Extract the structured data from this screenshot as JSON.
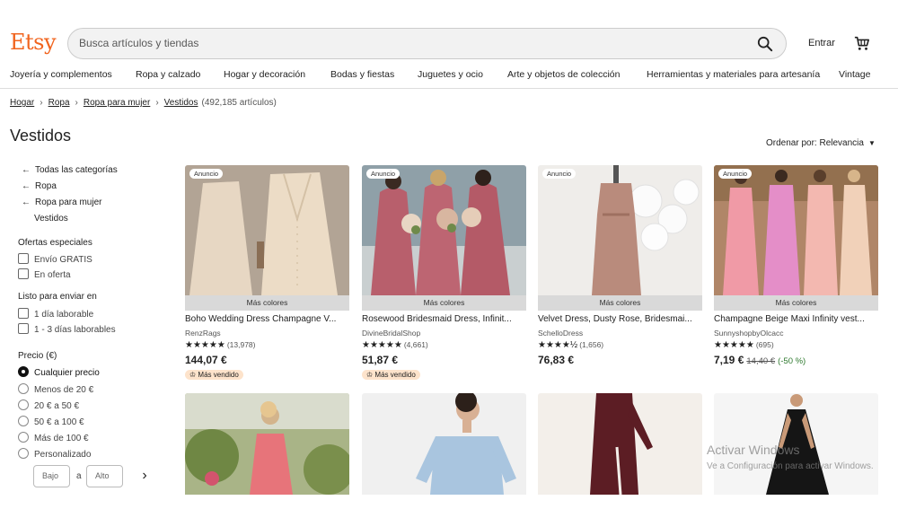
{
  "header": {
    "logo": "Etsy",
    "search_placeholder": "Busca artículos y tiendas",
    "signin": "Entrar"
  },
  "categories": [
    "Joyería y complementos",
    "Ropa y calzado",
    "Hogar y decoración",
    "Bodas y fiestas",
    "Juguetes y ocio",
    "Arte y objetos de colección",
    "Herramientas y materiales para artesanía",
    "Vintage"
  ],
  "breadcrumb": {
    "items": [
      "Hogar",
      "Ropa",
      "Ropa para mujer",
      "Vestidos"
    ],
    "count": "(492,185 artículos)"
  },
  "page_title": "Vestidos",
  "sort": {
    "label": "Ordenar por: Relevancia"
  },
  "sidebar": {
    "nav": [
      "Todas las categorías",
      "Ropa",
      "Ropa para mujer"
    ],
    "current": "Vestidos",
    "offers_heading": "Ofertas especiales",
    "offers": [
      "Envío GRATIS",
      "En oferta"
    ],
    "ready_heading": "Listo para enviar en",
    "ready": [
      "1 día laborable",
      "1 - 3 días laborables"
    ],
    "price_heading": "Precio (€)",
    "prices": [
      "Cualquier precio",
      "Menos de 20 €",
      "20 € a 50 €",
      "50 € a 100 €",
      "Más de 100 €",
      "Personalizado"
    ],
    "price_min_placeholder": "Bajo",
    "price_sep": "a",
    "price_max_placeholder": "Alto"
  },
  "products": [
    {
      "ad": "Anuncio",
      "colors": "Más colores",
      "title": "Boho Wedding Dress Champagne V...",
      "shop": "RenzRags",
      "stars": "★★★★★",
      "reviews": "(13,978)",
      "price": "144,07 €",
      "badge": "Más vendido"
    },
    {
      "ad": "Anuncio",
      "colors": "Más colores",
      "title": "Rosewood Bridesmaid Dress, Infinit...",
      "shop": "DivineBridalShop",
      "stars": "★★★★★",
      "reviews": "(4,661)",
      "price": "51,87 €",
      "badge": "Más vendido"
    },
    {
      "ad": "Anuncio",
      "colors": "Más colores",
      "title": "Velvet Dress, Dusty Rose, Bridesmai...",
      "shop": "SchelloDress",
      "stars": "★★★★½",
      "reviews": "(1,656)",
      "price": "76,83 €"
    },
    {
      "ad": "Anuncio",
      "colors": "Más colores",
      "title": "Champagne Beige Maxi Infinity vest...",
      "shop": "SunnyshopbyOlcacc",
      "stars": "★★★★★",
      "reviews": "(695)",
      "price": "7,19 €",
      "orig_price": "14,40 €",
      "discount": "(-50 %)"
    }
  ],
  "watermark": {
    "line1": "Activar Windows",
    "line2": "Ve a Configuración para activar Windows."
  }
}
